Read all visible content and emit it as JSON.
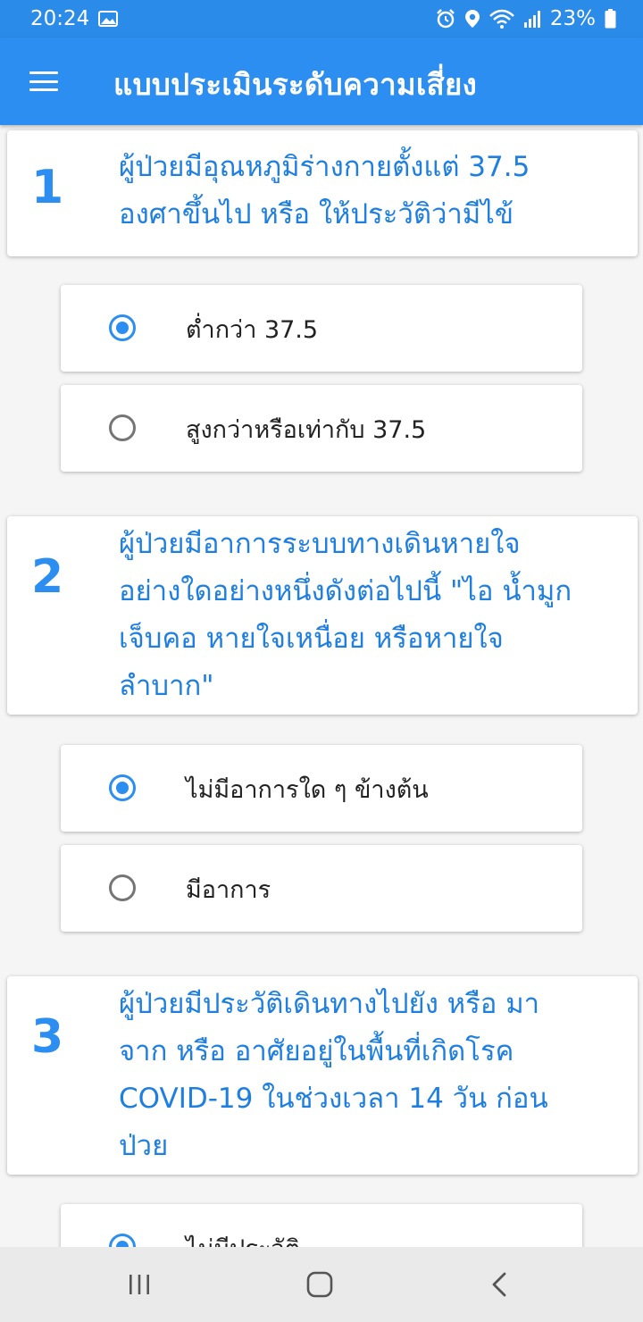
{
  "status_bar": {
    "time": "20:24",
    "battery": "23%",
    "icons": [
      "image-icon",
      "alarm-icon",
      "location-icon",
      "wifi-icon",
      "signal-icon",
      "battery-icon"
    ]
  },
  "app_bar": {
    "title": "แบบประเมินระดับความเสี่ยง",
    "menu_icon": "hamburger-menu-icon"
  },
  "colors": {
    "primary": "#2b8ef0",
    "question_text": "#1e7fe0",
    "radio_unchecked": "#757575"
  },
  "questions": [
    {
      "number": "1",
      "lines": [
        "ผู้ป่วยมีอุณหภูมิร่างกายตั้งแต่ 37.5",
        "องศาขึ้นไป หรือ ให้ประวัติว่ามีไข้"
      ],
      "options": [
        {
          "label": "ต่ำกว่า 37.5",
          "selected": true
        },
        {
          "label": "สูงกว่าหรือเท่ากับ 37.5",
          "selected": false
        }
      ]
    },
    {
      "number": "2",
      "lines": [
        "ผู้ป่วยมีอาการระบบทางเดินหายใจ",
        "อย่างใดอย่างหนึ่งดังต่อไปนี้ \"ไอ น้ำมูก",
        "เจ็บคอ หายใจเหนื่อย หรือหายใจ",
        "ลำบาก\""
      ],
      "options": [
        {
          "label": "ไม่มีอาการใด ๆ ข้างต้น",
          "selected": true
        },
        {
          "label": "มีอาการ",
          "selected": false
        }
      ]
    },
    {
      "number": "3",
      "lines": [
        "ผู้ป่วยมีประวัติเดินทางไปยัง หรือ มา",
        "จาก หรือ อาศัยอยู่ในพื้นที่เกิดโรค",
        "COVID-19 ในช่วงเวลา 14 วัน ก่อน",
        "ป่วย"
      ],
      "options": [
        {
          "label": "ไม่มีประวัติ",
          "selected": true
        }
      ]
    }
  ],
  "nav_bar": {
    "buttons": [
      "recent-apps-icon",
      "home-icon",
      "back-icon"
    ]
  }
}
